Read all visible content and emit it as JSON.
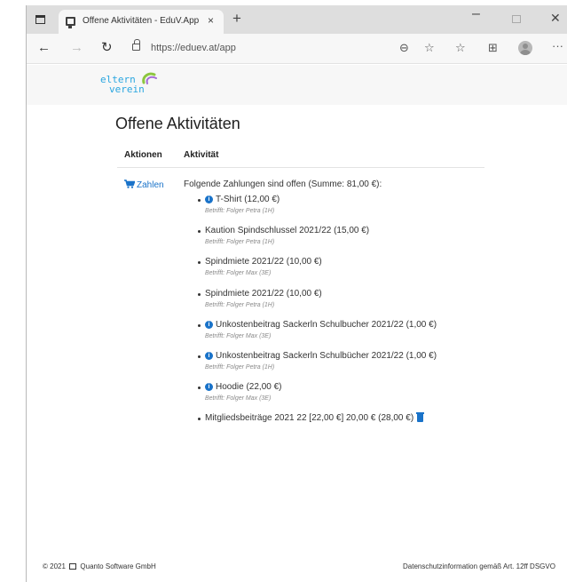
{
  "browser": {
    "tab_title": "Offene Aktivitäten - EduV.App",
    "tab_close": "×",
    "new_tab": "+",
    "url": "https://eduev.at/app",
    "icons": [
      "window-icon",
      "favicon-icon",
      "back-arrow-icon",
      "forward-arrow-icon",
      "reload-icon",
      "lock-icon",
      "zoom-icon",
      "add-favorite-icon",
      "favorites-icon",
      "collections-icon",
      "profile-avatar",
      "more-icon",
      "minimize-icon",
      "maximize-icon",
      "close-icon"
    ]
  },
  "site": {
    "logo_line1": "eltern",
    "logo_line2": "verein",
    "brand_colors": {
      "logo_blue": "#2aa6e0",
      "swirl_green": "#8dc63f",
      "swirl_purple": "#a56bd6",
      "link_blue": "#1a73c9"
    }
  },
  "page": {
    "title": "Offene Aktivitäten",
    "columns": {
      "actions": "Aktionen",
      "activity": "Aktivität"
    },
    "pay_label": "Zahlen",
    "summary": "Folgende Zahlungen sind offen (Summe: 81,00 €):",
    "items": [
      {
        "label": "T-Shirt (12,00 €)",
        "sub": "Betrifft: Folger Petra (1H)",
        "info": true,
        "trash": false
      },
      {
        "label": "Kaution Spindschlussel 2021/22 (15,00 €)",
        "sub": "Betrifft: Folger Petra (1H)",
        "info": false,
        "trash": false
      },
      {
        "label": "Spindmiete 2021/22 (10,00 €)",
        "sub": "Betrifft: Folger Max (3E)",
        "info": false,
        "trash": false
      },
      {
        "label": "Spindmiete 2021/22 (10,00 €)",
        "sub": "Betrifft: Folger Petra (1H)",
        "info": false,
        "trash": false
      },
      {
        "label": "Unkostenbeitrag Sackerln Schulbucher 2021/22 (1,00 €)",
        "sub": "Betrifft: Folger Max (3E)",
        "info": true,
        "trash": false
      },
      {
        "label": "Unkostenbeitrag Sackerln Schulbücher 2021/22 (1,00 €)",
        "sub": "Betrifft: Folger Petra (1H)",
        "info": true,
        "trash": false
      },
      {
        "label": "Hoodie (22,00 €)",
        "sub": "Betrifft: Folger Max (3E)",
        "info": true,
        "trash": false
      },
      {
        "label": "Mitgliedsbeiträge 2021 22 [22,00 €] 20,00 € (28,00 €)",
        "sub": "",
        "info": false,
        "trash": true
      }
    ]
  },
  "footer": {
    "copyright_prefix": "© 2021",
    "company": "Quanto Software GmbH",
    "privacy": "Datenschutzinformation gemäß Art. 12ff DSGVO"
  }
}
